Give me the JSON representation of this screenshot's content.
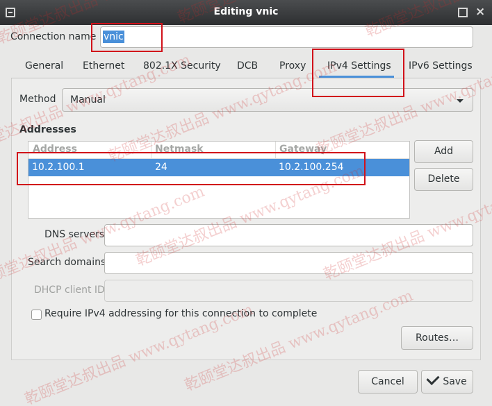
{
  "window": {
    "title": "Editing vnic"
  },
  "connection_name": {
    "label": "Connection name",
    "value": "vnic"
  },
  "tabs": [
    {
      "label": "General"
    },
    {
      "label": "Ethernet"
    },
    {
      "label": "802.1X Security"
    },
    {
      "label": "DCB"
    },
    {
      "label": "Proxy"
    },
    {
      "label": "IPv4 Settings",
      "selected": true
    },
    {
      "label": "IPv6 Settings"
    }
  ],
  "ipv4": {
    "method_label": "Method",
    "method_value": "Manual",
    "addresses_heading": "Addresses",
    "columns": [
      "Address",
      "Netmask",
      "Gateway"
    ],
    "rows": [
      {
        "address": "10.2.100.1",
        "netmask": "24",
        "gateway": "10.2.100.254",
        "selected": true
      }
    ],
    "add_label": "Add",
    "delete_label": "Delete",
    "dns_label": "DNS servers",
    "dns_value": "",
    "search_label": "Search domains",
    "search_value": "",
    "dhcp_label": "DHCP client ID",
    "dhcp_value": "",
    "require_label": "Require IPv4 addressing for this connection to complete",
    "require_checked": false,
    "routes_label": "Routes…"
  },
  "footer": {
    "cancel_label": "Cancel",
    "save_label": "Save"
  },
  "watermark_text": "乾颐堂达叔出品 www.qytang.com",
  "colors": {
    "accent": "#4a90d9",
    "annotation": "#d1111a",
    "titlebar": "#3a3c3e"
  }
}
